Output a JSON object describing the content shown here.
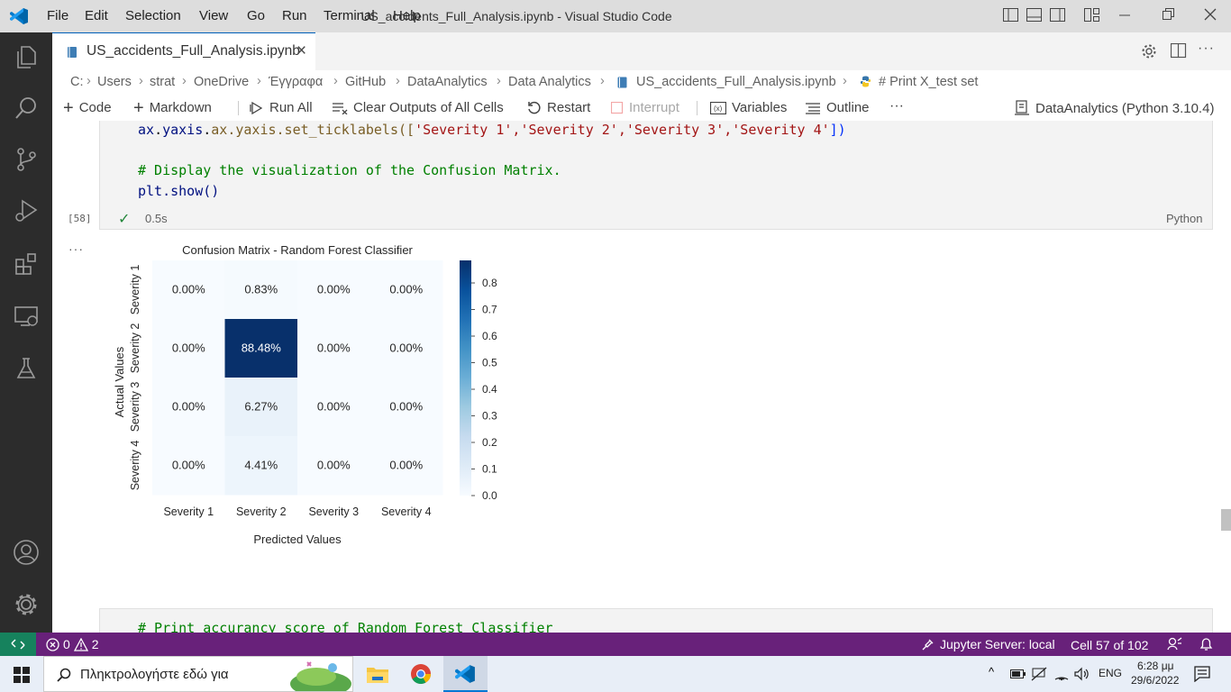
{
  "titlebar": {
    "menu": [
      "File",
      "Edit",
      "Selection",
      "View",
      "Go",
      "Run",
      "Terminal",
      "Help"
    ],
    "window_title": "US_accidents_Full_Analysis.ipynb - Visual Studio Code"
  },
  "activity_icons": [
    "explorer-icon",
    "search-icon",
    "source-control-icon",
    "run-debug-icon",
    "extensions-icon",
    "remote-explorer-icon",
    "testing-icon",
    "account-icon",
    "settings-gear-icon"
  ],
  "tab": {
    "label": "US_accidents_Full_Analysis.ipynb",
    "close": "×"
  },
  "breadcrumb": [
    "C:",
    "Users",
    "strat",
    "OneDrive",
    "Έγγραφα",
    "GitHub",
    "DataAnalytics",
    "Data Analytics",
    "US_accidents_Full_Analysis.ipynb",
    "# Print X_test set"
  ],
  "toolbar": {
    "code": "Code",
    "markdown": "Markdown",
    "run_all": "Run All",
    "clear_outputs": "Clear Outputs of All Cells",
    "restart": "Restart",
    "interrupt": "Interrupt",
    "variables": "Variables",
    "outline": "Outline",
    "more": "···",
    "kernel": "DataAnalytics (Python 3.10.4)"
  },
  "cell": {
    "line1": "ax.yaxis.set_ticklabels([",
    "line1_args": "'Severity 1','Severity 2','Severity 3','Severity 4'",
    "line1_end": "])",
    "comment": "# Display the visualization of the Confusion Matrix.",
    "line3": "plt.show()",
    "exec_count": "[58]",
    "check": "✓",
    "duration": "0.5s",
    "language": "Python",
    "output_menu": "···"
  },
  "chart_data": {
    "type": "heatmap",
    "title": "Confusion Matrix - Random Forest Classifier",
    "xlabel": "Predicted Values",
    "ylabel": "Actual Values",
    "x_categories": [
      "Severity 1",
      "Severity 2",
      "Severity 3",
      "Severity 4"
    ],
    "y_categories": [
      "Severity 1",
      "Severity 2",
      "Severity 3",
      "Severity 4"
    ],
    "values": [
      [
        0.0,
        0.0083,
        0.0,
        0.0
      ],
      [
        0.0,
        0.8848,
        0.0,
        0.0
      ],
      [
        0.0,
        0.0627,
        0.0,
        0.0
      ],
      [
        0.0,
        0.0441,
        0.0,
        0.0
      ]
    ],
    "annotations": [
      [
        "0.00%",
        "0.83%",
        "0.00%",
        "0.00%"
      ],
      [
        "0.00%",
        "88.48%",
        "0.00%",
        "0.00%"
      ],
      [
        "0.00%",
        "6.27%",
        "0.00%",
        "0.00%"
      ],
      [
        "0.00%",
        "4.41%",
        "0.00%",
        "0.00%"
      ]
    ],
    "colorbar_ticks": [
      "0.0",
      "0.1",
      "0.2",
      "0.3",
      "0.4",
      "0.5",
      "0.6",
      "0.7",
      "0.8"
    ],
    "colorbar_range": [
      0,
      0.8848
    ],
    "colormap": "Blues"
  },
  "next_cell": {
    "comment": "# Print accurancy score of Random Forest Classifier"
  },
  "statusbar": {
    "remote": "><",
    "errors": "0",
    "warnings": "2",
    "jupyter": "Jupyter Server: local",
    "cell_pos": "Cell 57 of 102"
  },
  "taskbar": {
    "search_placeholder": "Πληκτρολογήστε εδώ για",
    "lang": "ENG",
    "time": "6:28 μμ",
    "date": "29/6/2022"
  },
  "colors": {
    "statusbar": "#68217a",
    "activity": "#2c2c2c",
    "accent": "#005fb8"
  }
}
